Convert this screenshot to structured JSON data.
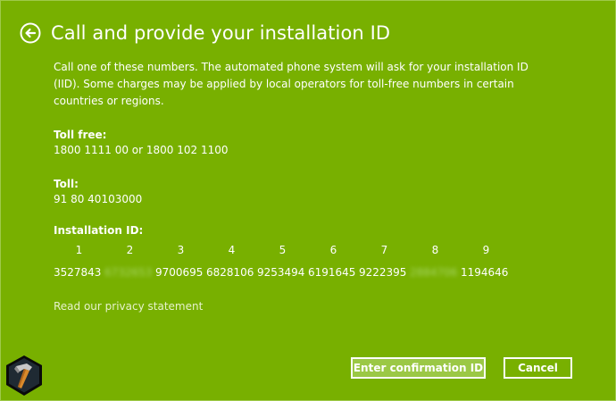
{
  "header": {
    "title": "Call and provide your installation ID",
    "back_icon": "back-arrow-icon"
  },
  "description": "Call one of these numbers. The automated phone system will ask for your installation ID (IID). Some charges may be applied by local operators for toll-free numbers in certain countries or regions.",
  "toll_free": {
    "label": "Toll free:",
    "value": "1800 1111 00 or 1800 102 1100"
  },
  "toll": {
    "label": "Toll:",
    "value": "91 80 40103000"
  },
  "installation_id": {
    "label": "Installation ID:",
    "columns": [
      "1",
      "2",
      "3",
      "4",
      "5",
      "6",
      "7",
      "8",
      "9"
    ],
    "values": [
      "3527843",
      "6732653",
      "9700695",
      "6828106",
      "9253494",
      "6191645",
      "9222395",
      "2884706",
      "1194646"
    ]
  },
  "links": {
    "privacy": "Read our privacy statement"
  },
  "buttons": {
    "confirm": "Enter confirmation ID",
    "cancel": "Cancel"
  },
  "colors": {
    "background": "#78b000",
    "confirm_button": "#9bc845"
  }
}
